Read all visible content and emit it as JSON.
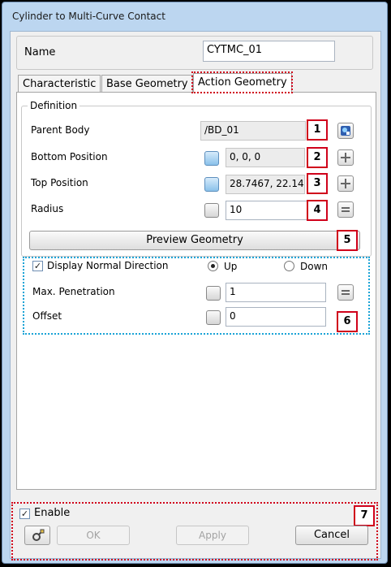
{
  "window": {
    "title": "Cylinder to Multi-Curve Contact"
  },
  "name": {
    "label": "Name",
    "value": "CYTMC_01"
  },
  "tabs": [
    {
      "label": "Characteristic",
      "active": false
    },
    {
      "label": "Base Geometry",
      "active": false
    },
    {
      "label": "Action Geometry",
      "active": true
    }
  ],
  "definition": {
    "title": "Definition",
    "parent_body": {
      "label": "Parent Body",
      "value": "/BD_01"
    },
    "bottom_position": {
      "label": "Bottom Position",
      "value": "0, 0, 0"
    },
    "top_position": {
      "label": "Top Position",
      "value": "28.7467, 22.14"
    },
    "radius": {
      "label": "Radius",
      "value": "10"
    }
  },
  "preview_button": "Preview Geometry",
  "options": {
    "display_normal_direction": {
      "label": "Display Normal Direction",
      "checked": true
    },
    "up_label": "Up",
    "down_label": "Down",
    "selected_direction": "Up",
    "max_penetration": {
      "label": "Max. Penetration",
      "value": "1"
    },
    "offset": {
      "label": "Offset",
      "value": "0"
    }
  },
  "footer": {
    "enable": {
      "label": "Enable",
      "checked": true
    },
    "ok": "OK",
    "apply": "Apply",
    "cancel": "Cancel"
  },
  "callouts": [
    "1",
    "2",
    "3",
    "4",
    "5",
    "6",
    "7"
  ],
  "colors": {
    "callout_red": "#d0021b",
    "highlight_cyan": "#1aa3d6",
    "frame_blue": "#bcd6f0"
  },
  "icons": {
    "parent_body": "body-select-icon",
    "position": "crosshair-icon",
    "radius": "equals-icon",
    "footer": "tool-icon"
  }
}
